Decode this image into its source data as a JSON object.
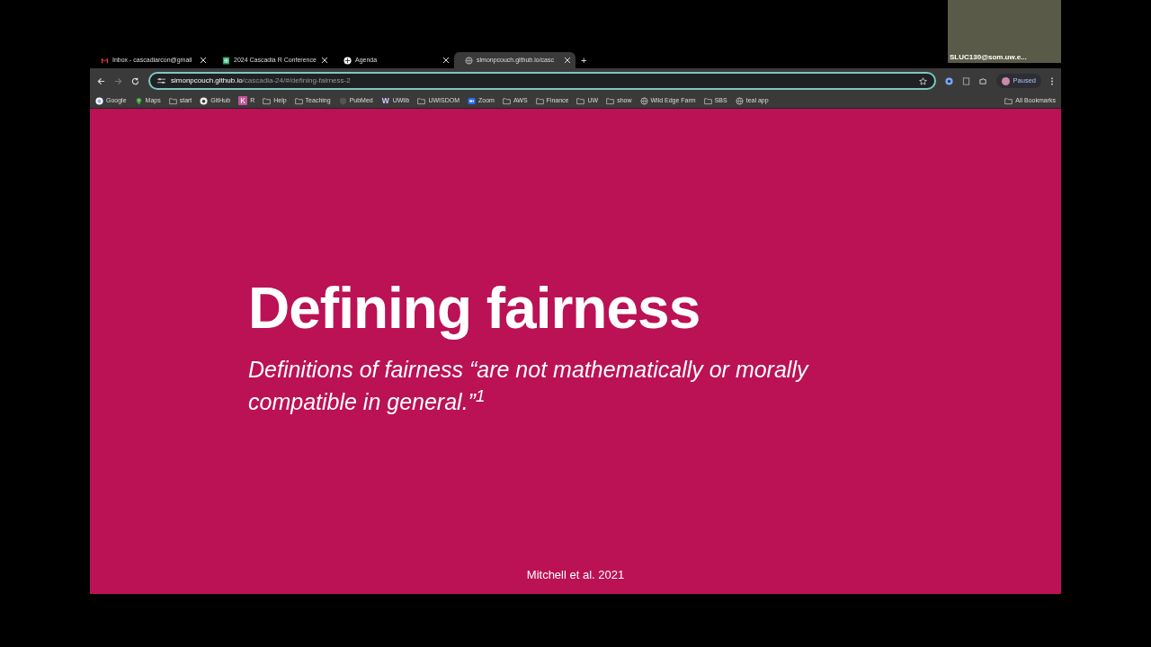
{
  "video_inset": {
    "caption": "SLUC130@som.uw.e..."
  },
  "tabs": [
    {
      "title": "Inbox - cascadiarcon@gmail",
      "kind": "mail",
      "selected": false
    },
    {
      "title": "2024 Cascadia R Conference",
      "kind": "sheet",
      "selected": false
    },
    {
      "title": "Agenda",
      "kind": "logo",
      "selected": false
    },
    {
      "title": "simonpcouch.github.io/casc",
      "kind": "globe",
      "selected": true
    }
  ],
  "new_tab": "+",
  "address_bar": {
    "host": "simonpcouch.github.io",
    "path": "/cascadia-24/#/defining-fairness-2"
  },
  "profile": {
    "label": "Paused"
  },
  "bookmarks": [
    {
      "label": "Google",
      "kind": "google"
    },
    {
      "label": "Maps",
      "kind": "pin"
    },
    {
      "label": "start",
      "kind": "folder"
    },
    {
      "label": "GitHub",
      "kind": "github"
    },
    {
      "label": "R",
      "kind": "letter",
      "letter": "K"
    },
    {
      "label": "Help",
      "kind": "folder"
    },
    {
      "label": "Teaching",
      "kind": "folder"
    },
    {
      "label": "PubMed",
      "kind": "shield"
    },
    {
      "label": "UWlib",
      "kind": "letter",
      "letter": "W"
    },
    {
      "label": "UWISDOM",
      "kind": "folder"
    },
    {
      "label": "Zoom",
      "kind": "zoom"
    },
    {
      "label": "AWS",
      "kind": "folder"
    },
    {
      "label": "Finance",
      "kind": "folder"
    },
    {
      "label": "UW",
      "kind": "folder"
    },
    {
      "label": "show",
      "kind": "folder"
    },
    {
      "label": "Wild Edge Farm",
      "kind": "globe"
    },
    {
      "label": "SBS",
      "kind": "folder"
    },
    {
      "label": "teal app",
      "kind": "globe"
    }
  ],
  "all_bookmarks": "All Bookmarks",
  "slide": {
    "title": "Defining fairness",
    "subtitle": "Definitions of fairness “are not mathematically or morally compatible in general.”$^{1}$",
    "footer": "Mitchell et al. 2021"
  }
}
